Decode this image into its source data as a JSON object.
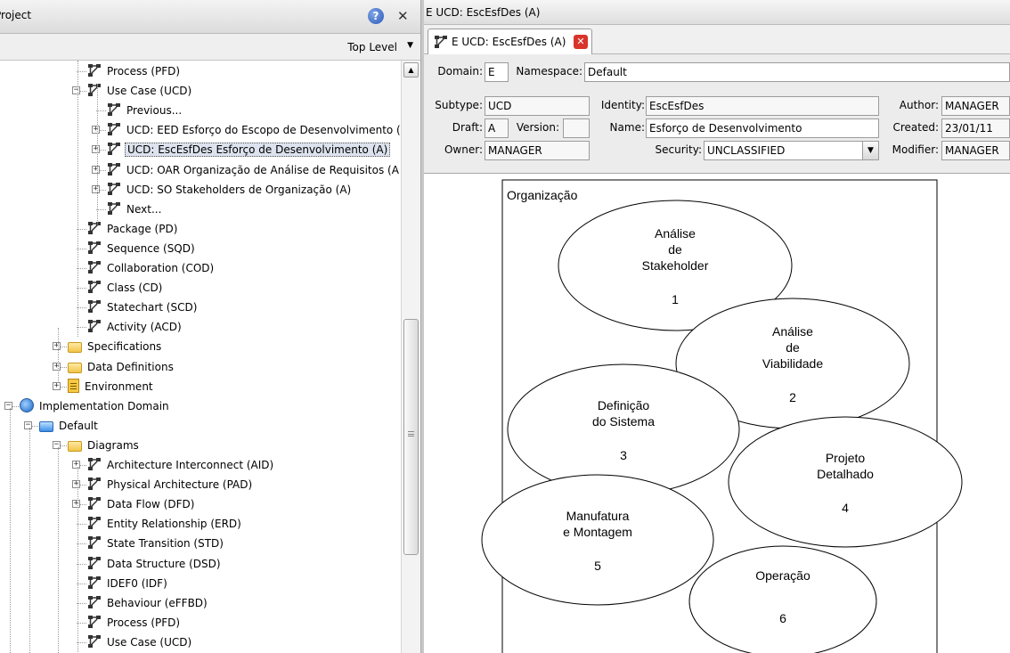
{
  "left_panel": {
    "title": "Project",
    "top_level_label": "Top Level",
    "tree": [
      {
        "label": "Process (PFD)"
      },
      {
        "label": "Use Case (UCD)"
      },
      {
        "label": "Previous..."
      },
      {
        "label": "UCD: EED Esforço do Escopo de Desenvolvimento ("
      },
      {
        "label": "UCD: EscEsfDes Esforço de Desenvolvimento (A)"
      },
      {
        "label": "UCD: OAR Organização de Análise de Requisitos (A"
      },
      {
        "label": "UCD: SO Stakeholders de Organização (A)"
      },
      {
        "label": "Next..."
      },
      {
        "label": "Package (PD)"
      },
      {
        "label": "Sequence (SQD)"
      },
      {
        "label": "Collaboration (COD)"
      },
      {
        "label": "Class (CD)"
      },
      {
        "label": "Statechart (SCD)"
      },
      {
        "label": "Activity (ACD)"
      },
      {
        "label": "Specifications"
      },
      {
        "label": "Data Definitions"
      },
      {
        "label": "Environment"
      },
      {
        "label": "Implementation Domain"
      },
      {
        "label": "Default"
      },
      {
        "label": "Diagrams"
      },
      {
        "label": "Architecture Interconnect (AID)"
      },
      {
        "label": "Physical Architecture (PAD)"
      },
      {
        "label": "Data Flow (DFD)"
      },
      {
        "label": "Entity Relationship (ERD)"
      },
      {
        "label": "State Transition (STD)"
      },
      {
        "label": "Data Structure (DSD)"
      },
      {
        "label": "IDEF0 (IDF)"
      },
      {
        "label": "Behaviour (eFFBD)"
      },
      {
        "label": "Process (PFD)"
      },
      {
        "label": "Use Case (UCD)"
      }
    ]
  },
  "right_panel": {
    "window_title": "E UCD: EscEsfDes (A)",
    "tab_label": "E UCD: EscEsfDes (A)",
    "props": {
      "domain_label": "Domain:",
      "domain_value": "E",
      "namespace_label": "Namespace:",
      "namespace_value": "Default",
      "subtype_label": "Subtype:",
      "subtype_value": "UCD",
      "identity_label": "Identity:",
      "identity_value": "EscEsfDes",
      "author_label": "Author:",
      "author_value": "MANAGER",
      "draft_label": "Draft:",
      "draft_value": "A",
      "version_label": "Version:",
      "version_value": "",
      "name_label": "Name:",
      "name_value": "Esforço de Desenvolvimento",
      "created_label": "Created:",
      "created_value": "23/01/11",
      "owner_label": "Owner:",
      "owner_value": "MANAGER",
      "security_label": "Security:",
      "security_value": "UNCLASSIFIED",
      "modifier_label": "Modifier:",
      "modifier_value": "MANAGER"
    },
    "diagram": {
      "boundary_label": "Organização",
      "use_cases": [
        {
          "lines": [
            "Análise",
            "de",
            "Stakeholder"
          ],
          "number": "1"
        },
        {
          "lines": [
            "Análise",
            "de",
            "Viabilidade"
          ],
          "number": "2"
        },
        {
          "lines": [
            "Definição",
            "do Sistema"
          ],
          "number": "3"
        },
        {
          "lines": [
            "Projeto",
            "Detalhado"
          ],
          "number": "4"
        },
        {
          "lines": [
            "Manufatura",
            "e Montagem"
          ],
          "number": "5"
        },
        {
          "lines": [
            "Operação"
          ],
          "number": "6"
        }
      ]
    }
  },
  "colors": {
    "selection": "#dde3ee",
    "folder": "#f1c54a",
    "close_red": "#d9342b"
  }
}
